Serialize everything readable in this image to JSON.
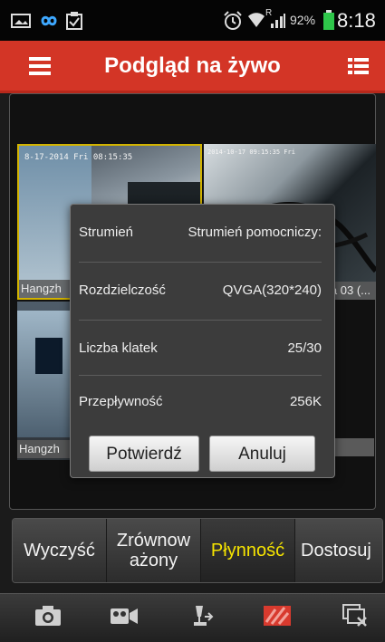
{
  "status_bar": {
    "battery": "92%",
    "time": "8:18",
    "signal_superscript": "R"
  },
  "action_bar": {
    "title": "Podgląd na żywo"
  },
  "cameras": [
    {
      "timestamp": "8-17-2014 Fri 08:15:35",
      "label": "Hangzh"
    },
    {
      "timestamp": "2014-10-17 09:15:35 Fri",
      "label": "a 03 (..."
    },
    {
      "label": "Hangzh"
    }
  ],
  "dialog": {
    "rows": [
      {
        "label": "Strumień",
        "value": "Strumień pomocniczy:"
      },
      {
        "label": "Rozdzielczość",
        "value": "QVGA(320*240)"
      },
      {
        "label": "Liczba klatek",
        "value": "25/30"
      },
      {
        "label": "Przepływność",
        "value": "256K"
      }
    ],
    "confirm_label": "Potwierdź",
    "cancel_label": "Anuluj"
  },
  "modes": {
    "items": [
      {
        "label": "Wyczyść"
      },
      {
        "label": "Zrównow ażony"
      },
      {
        "label": "Płynność"
      },
      {
        "label": "Dostosuj"
      }
    ],
    "selected": "Płynność"
  },
  "toolbar_icons": [
    "camera-icon",
    "video-record-icon",
    "ptz-icon",
    "image-quality-icon",
    "close-all-icon"
  ],
  "colors": {
    "accent": "#d33526",
    "selected_mode": "#f6e400"
  }
}
